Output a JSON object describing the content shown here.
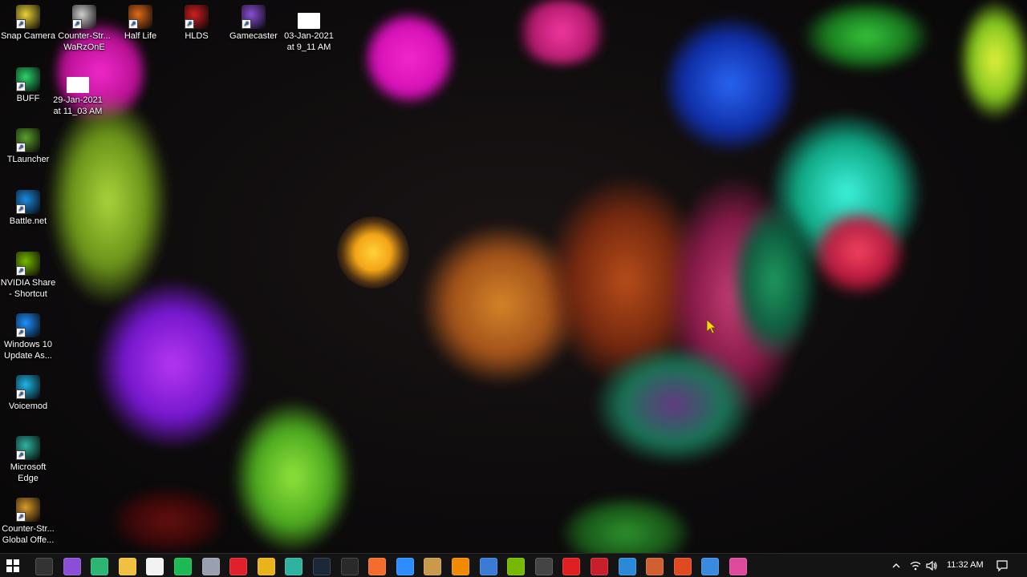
{
  "desktop": {
    "icons": [
      {
        "label": "Snap Camera",
        "icon": "snap-camera-icon",
        "color": "#e8d23a"
      },
      {
        "label": "Counter-Str... WaRzOnE",
        "icon": "counter-strike-icon",
        "color": "#d0d0d0"
      },
      {
        "label": "Half Life",
        "icon": "half-life-icon",
        "color": "#e06a1a"
      },
      {
        "label": "HLDS",
        "icon": "hlds-icon",
        "color": "#d02020"
      },
      {
        "label": "Gamecaster",
        "icon": "gamecaster-icon",
        "color": "#8a4fd6"
      },
      {
        "label": "03-Jan-2021 at 9_11 AM",
        "icon": "image-file-icon",
        "color": "#ffffff"
      },
      {
        "label": "BUFF",
        "icon": "buff-icon",
        "color": "#2bd46a"
      },
      {
        "label": "29-Jan-2021 at 11_03 AM",
        "icon": "image-file-icon",
        "color": "#ffffff"
      },
      {
        "label": "TLauncher",
        "icon": "tlauncher-icon",
        "color": "#5aa02c"
      },
      {
        "label": "Battle.net",
        "icon": "battle-net-icon",
        "color": "#1a8be0"
      },
      {
        "label": "NVIDIA Share - Shortcut",
        "icon": "nvidia-icon",
        "color": "#76b900"
      },
      {
        "label": "Windows 10 Update As...",
        "icon": "windows-update-icon",
        "color": "#1e90ff"
      },
      {
        "label": "Voicemod",
        "icon": "voicemod-icon",
        "color": "#1fb6e8"
      },
      {
        "label": "Microsoft Edge",
        "icon": "edge-icon",
        "color": "#2fb3a0"
      },
      {
        "label": "Counter-Str... Global Offe...",
        "icon": "csgo-icon",
        "color": "#d99a2b"
      }
    ]
  },
  "taskbar": {
    "start_label": "Start",
    "pinned": [
      {
        "name": "cortana-icon",
        "color": "#333333"
      },
      {
        "name": "gamecaster-taskbar-icon",
        "color": "#8a4fd6"
      },
      {
        "name": "app-green-icon",
        "color": "#2bb673"
      },
      {
        "name": "file-explorer-icon",
        "color": "#f0c040"
      },
      {
        "name": "store-icon",
        "color": "#f2f2f2"
      },
      {
        "name": "spotify-icon",
        "color": "#1db954"
      },
      {
        "name": "app-gray-icon",
        "color": "#9aa0b0"
      },
      {
        "name": "opera-icon",
        "color": "#e0202a"
      },
      {
        "name": "chrome-icon",
        "color": "#e8b41a"
      },
      {
        "name": "edge-taskbar-icon",
        "color": "#2fb3a0"
      },
      {
        "name": "steam-icon",
        "color": "#1b2838"
      },
      {
        "name": "epic-games-icon",
        "color": "#2a2a2a"
      },
      {
        "name": "origin-icon",
        "color": "#f56c2d"
      },
      {
        "name": "zoom-icon",
        "color": "#2d8cff"
      },
      {
        "name": "media-icon",
        "color": "#c89a4a"
      },
      {
        "name": "vlc-icon",
        "color": "#f08a00"
      },
      {
        "name": "app-blue-icon",
        "color": "#3a7bd5"
      },
      {
        "name": "nvidia-taskbar-icon",
        "color": "#76b900"
      },
      {
        "name": "calculator-icon",
        "color": "#444444"
      },
      {
        "name": "roblox-icon",
        "color": "#e02020"
      },
      {
        "name": "valorant-icon",
        "color": "#c8202a"
      },
      {
        "name": "vscode-icon",
        "color": "#2a8ad8"
      },
      {
        "name": "game-icon",
        "color": "#d06030"
      },
      {
        "name": "office-icon",
        "color": "#e04a20"
      },
      {
        "name": "photos-icon",
        "color": "#3a8ae0"
      },
      {
        "name": "color-picker-icon",
        "color": "#e04a9a"
      }
    ],
    "clock": "11:32 AM"
  },
  "colors": {
    "taskbar_bg": "#141414",
    "desktop_text": "#ffffff"
  }
}
